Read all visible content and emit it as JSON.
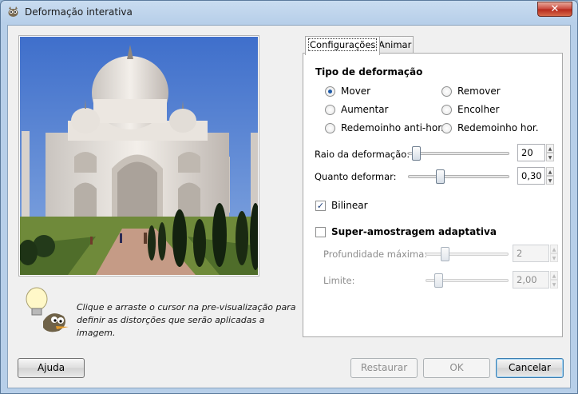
{
  "window": {
    "title": "Deformação interativa",
    "close_label": "✕"
  },
  "preview": {
    "hint": "Clique e arraste o cursor na pre-visualização para definir as distorções que serão aplicadas a imagem."
  },
  "tabs": [
    {
      "label": "Configurações",
      "active": true
    },
    {
      "label": "Animar",
      "active": false
    }
  ],
  "deform_type": {
    "title": "Tipo de deformação",
    "options": [
      {
        "label": "Mover",
        "checked": true
      },
      {
        "label": "Remover",
        "checked": false
      },
      {
        "label": "Aumentar",
        "checked": false
      },
      {
        "label": "Encolher",
        "checked": false
      },
      {
        "label": "Redemoinho anti-hor.",
        "checked": false
      },
      {
        "label": "Redemoinho hor.",
        "checked": false
      }
    ]
  },
  "sliders": {
    "radius": {
      "label": "Raio da deformação:",
      "value": "20",
      "fraction": 0.04
    },
    "amount": {
      "label": "Quanto deformar:",
      "value": "0,30",
      "fraction": 0.3
    }
  },
  "bilinear": {
    "label": "Bilinear",
    "checked": true
  },
  "supersampling": {
    "label": "Super-amostragem adaptativa",
    "checked": false
  },
  "adaptive": {
    "depth": {
      "label": "Profundidade máxima:",
      "value": "2",
      "fraction": 0.2
    },
    "threshold": {
      "label": "Limite:",
      "value": "2,00",
      "fraction": 0.12
    }
  },
  "buttons": {
    "help": "Ajuda",
    "reset": "Restaurar",
    "ok": "OK",
    "cancel": "Cancelar"
  },
  "colors": {
    "accent": "#1e5aa8",
    "close_red": "#c8463a"
  }
}
